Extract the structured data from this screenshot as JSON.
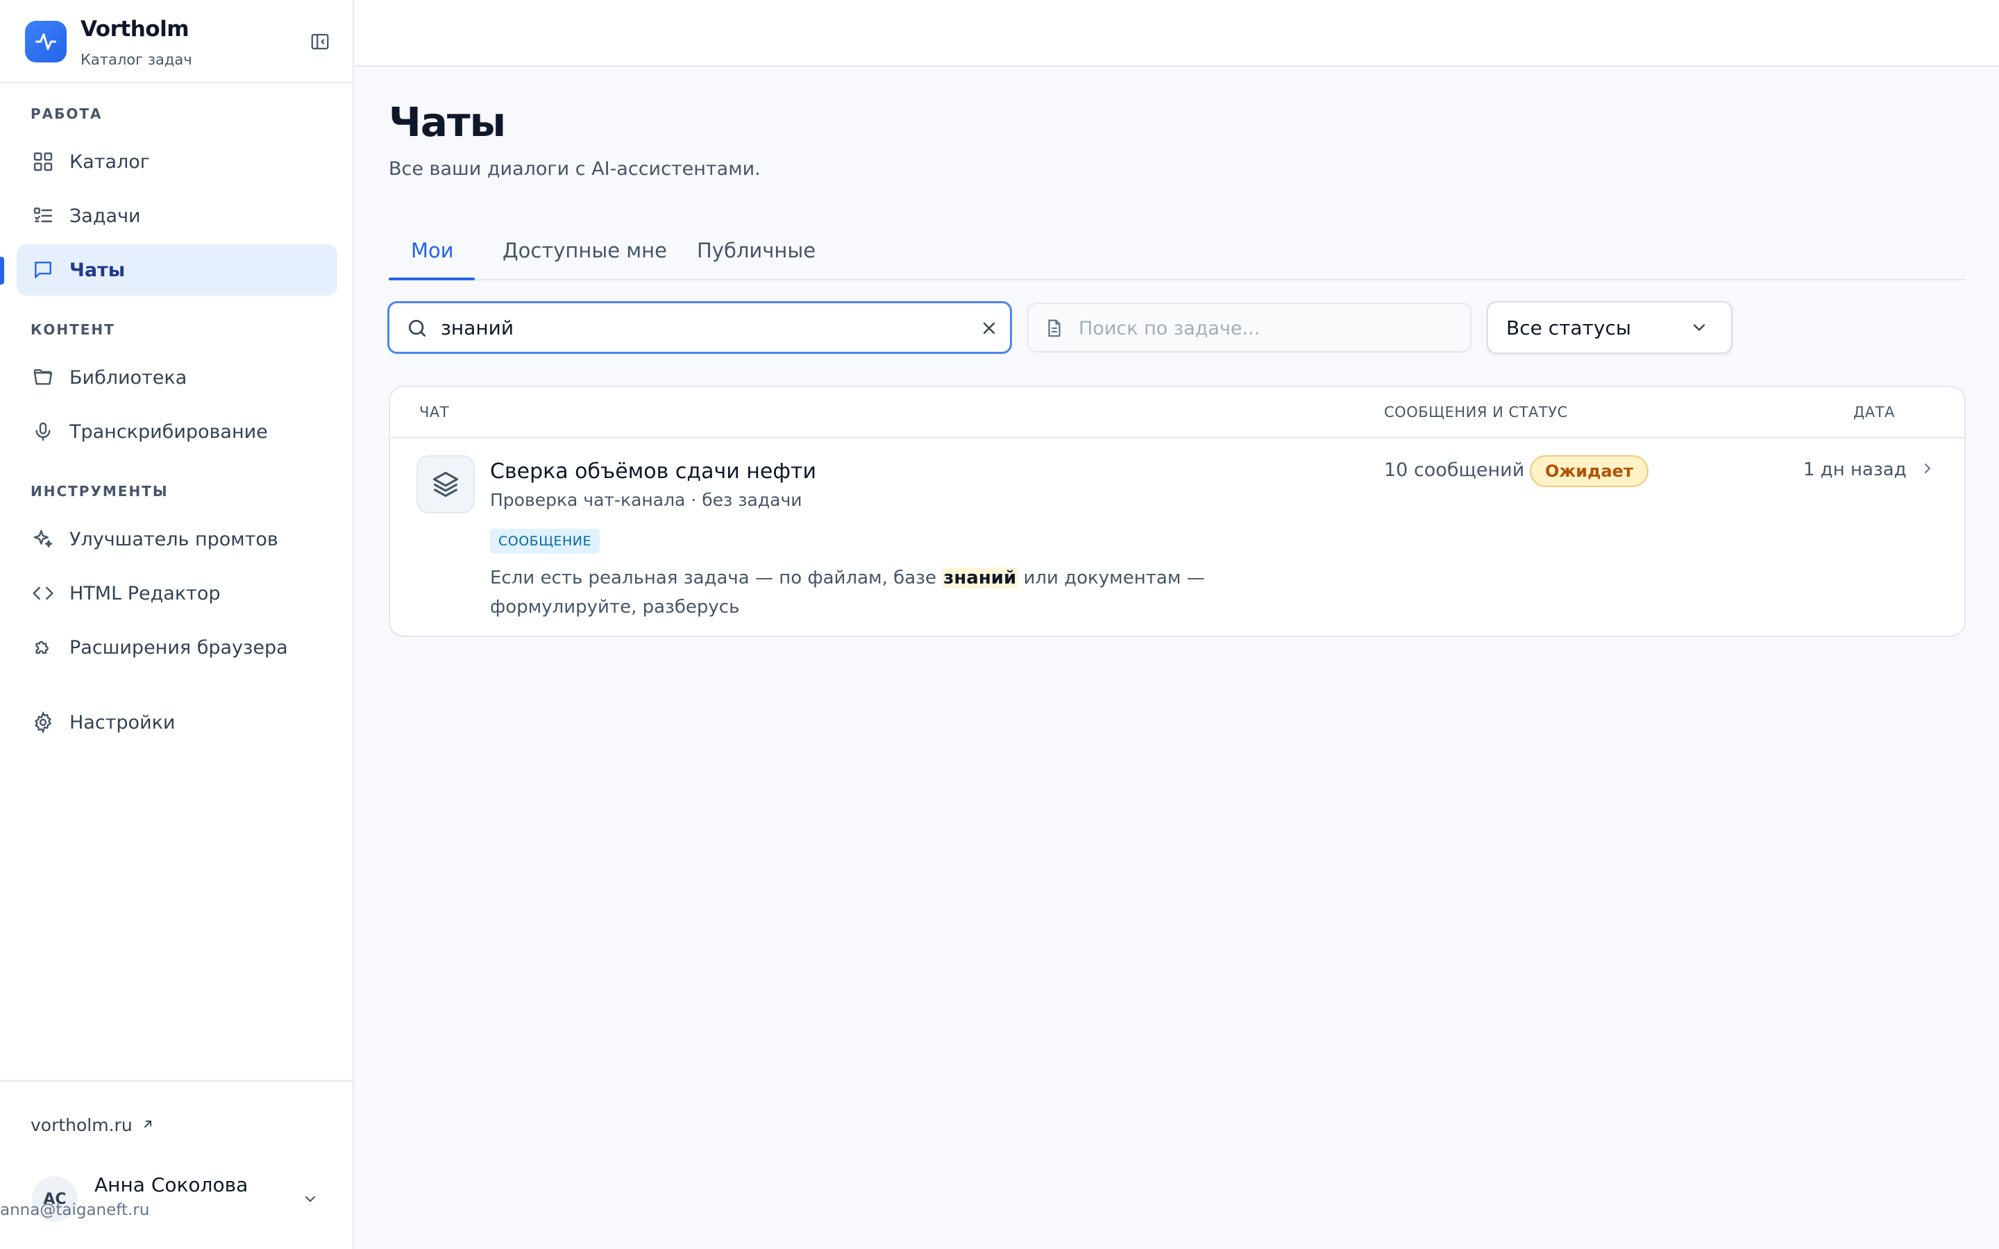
{
  "brand": {
    "name": "Vortholm",
    "subtitle": "Каталог задач"
  },
  "sidebar": {
    "sections": [
      {
        "label": "РАБОТА",
        "items": [
          {
            "label": "Каталог",
            "icon": "grid-icon"
          },
          {
            "label": "Задачи",
            "icon": "task-list-icon"
          },
          {
            "label": "Чаты",
            "icon": "chat-icon",
            "active": true
          }
        ]
      },
      {
        "label": "КОНТЕНТ",
        "items": [
          {
            "label": "Библиотека",
            "icon": "folder-icon"
          },
          {
            "label": "Транскрибирование",
            "icon": "microphone-icon"
          }
        ]
      },
      {
        "label": "ИНСТРУМЕНТЫ",
        "items": [
          {
            "label": "Улучшатель промтов",
            "icon": "sparkles-icon"
          },
          {
            "label": "HTML Редактор",
            "icon": "code-icon"
          },
          {
            "label": "Расширения браузера",
            "icon": "puzzle-icon"
          }
        ]
      }
    ],
    "settings": {
      "label": "Настройки",
      "icon": "gear-icon"
    },
    "footer": {
      "site_link": "vortholm.ru",
      "user": {
        "initials": "АС",
        "name": "Анна Соколова",
        "email": "anna@taiganeft.ru"
      }
    }
  },
  "main": {
    "title": "Чаты",
    "subtitle": "Все ваши диалоги с AI-ассистентами.",
    "tabs": [
      {
        "label": "Мои",
        "active": true
      },
      {
        "label": "Доступные мне"
      },
      {
        "label": "Публичные"
      }
    ],
    "filters": {
      "search_value": "знаний",
      "task_placeholder": "Поиск по задаче...",
      "status_value": "Все статусы"
    },
    "table": {
      "columns": {
        "chat": "ЧАТ",
        "messages_status": "СООБЩЕНИЯ И СТАТУС",
        "date": "ДАТА"
      },
      "rows": [
        {
          "title": "Сверка объёмов сдачи нефти",
          "meta": "Проверка чат-канала · без задачи",
          "match_type": "СООБЩЕНИЕ",
          "snippet_before": "Если есть реальная задача — по файлам, базе ",
          "snippet_match": "знаний",
          "snippet_after": " или документам — формулируйте, разберусь",
          "messages": "10 сообщений",
          "status": "Ожидает",
          "date": "1 дн назад"
        }
      ]
    }
  },
  "colors": {
    "accent": "#2563eb",
    "active_bg": "#e6effd",
    "status_pending": "#b45309",
    "highlight": "#fef6d8"
  }
}
